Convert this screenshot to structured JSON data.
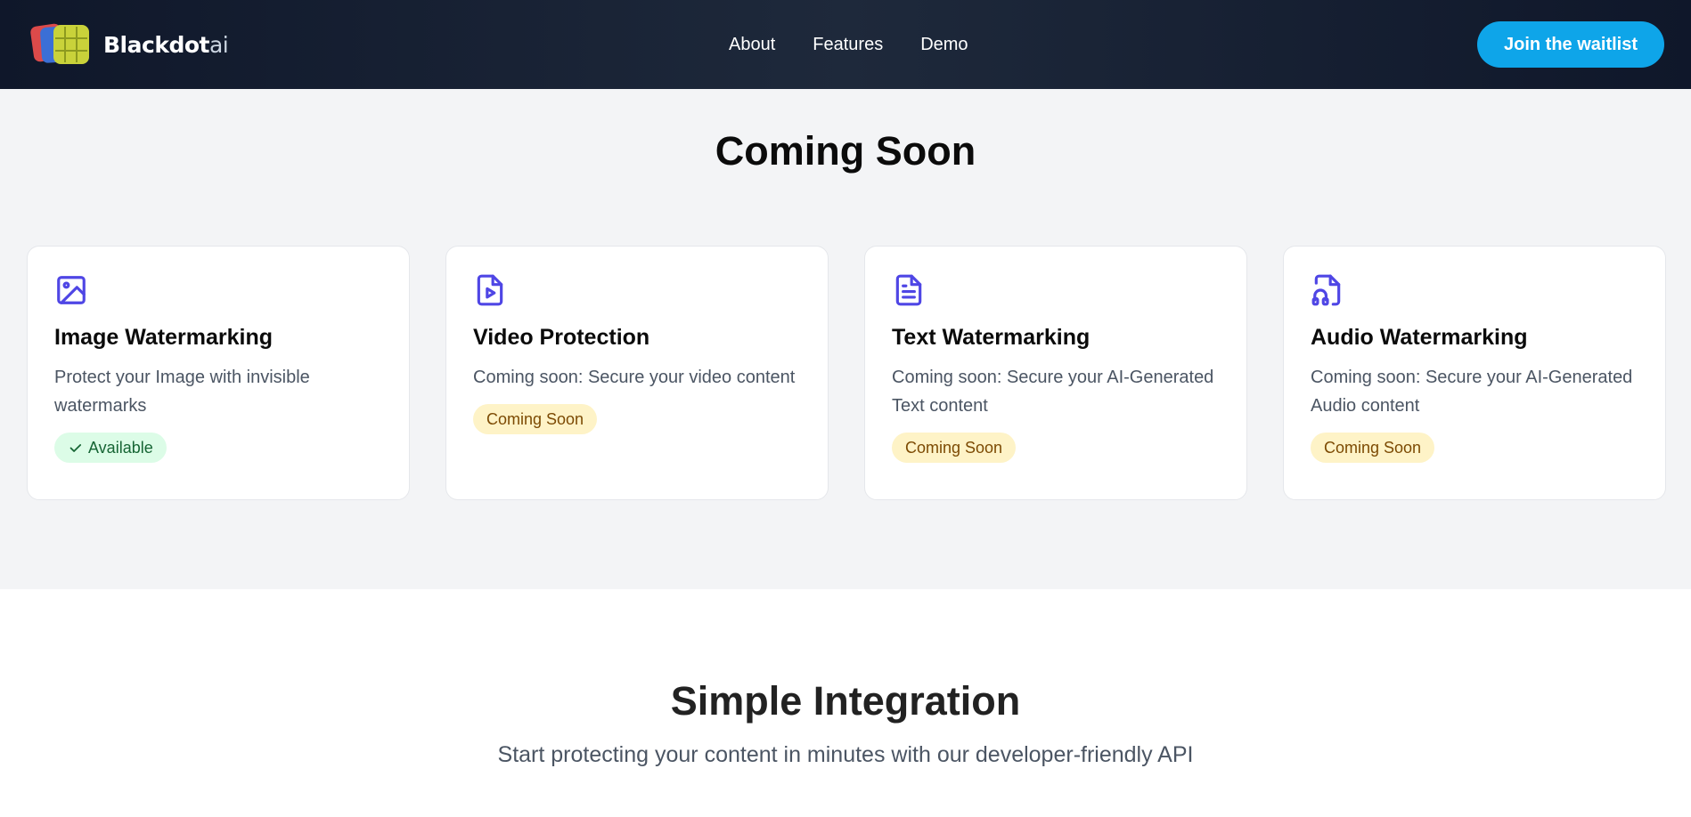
{
  "header": {
    "brand_main": "Blackdot",
    "brand_suffix": "ai",
    "nav": [
      {
        "label": "About"
      },
      {
        "label": "Features"
      },
      {
        "label": "Demo"
      }
    ],
    "cta_label": "Join the waitlist"
  },
  "coming_soon": {
    "title": "Coming Soon",
    "cards": [
      {
        "icon": "image-icon",
        "title": "Image Watermarking",
        "description": "Protect your Image with invisible watermarks",
        "badge": "Available"
      },
      {
        "icon": "video-file-icon",
        "title": "Video Protection",
        "description": "Coming soon: Secure your video content",
        "badge": "Coming Soon"
      },
      {
        "icon": "text-file-icon",
        "title": "Text Watermarking",
        "description": "Coming soon: Secure your AI-Generated Text content",
        "badge": "Coming Soon"
      },
      {
        "icon": "audio-file-icon",
        "title": "Audio Watermarking",
        "description": "Coming soon: Secure your AI-Generated Audio content",
        "badge": "Coming Soon"
      }
    ]
  },
  "integration": {
    "title": "Simple Integration",
    "subtitle": "Start protecting your content in minutes with our developer-friendly API"
  },
  "colors": {
    "accent": "#4f46e5",
    "cta": "#0ea5e9",
    "available_bg": "#dcfce7",
    "soon_bg": "#fef3c7"
  }
}
